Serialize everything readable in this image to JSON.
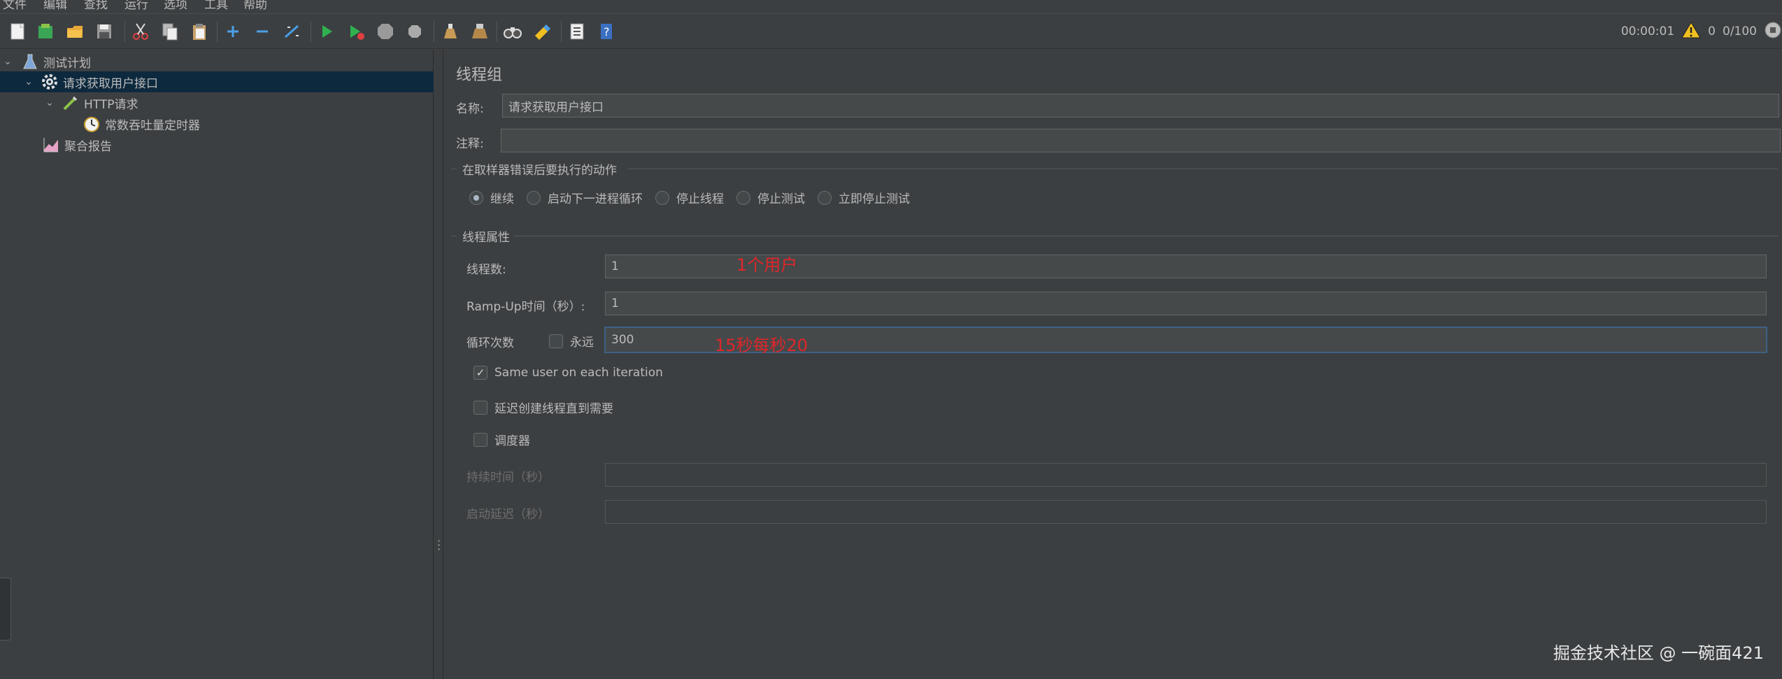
{
  "menu": [
    "文件",
    "编辑",
    "查找",
    "运行",
    "选项",
    "工具",
    "帮助"
  ],
  "toolbar": {
    "icons": [
      "new-icon",
      "templates-icon",
      "open-icon",
      "save-icon",
      "cut-icon",
      "copy-icon",
      "paste-icon",
      "add-icon",
      "remove-icon",
      "toggle-icon",
      "start-icon",
      "start-no-pause-icon",
      "stop-icon",
      "shutdown-icon",
      "clear-icon",
      "clear-all-icon",
      "search-icon",
      "reset-search-icon",
      "function-helper-icon",
      "help-icon"
    ]
  },
  "status": {
    "elapsed": "00:00:01",
    "warnings": "0",
    "threads": "0/100"
  },
  "tree": [
    {
      "label": "测试计划",
      "icon": "test-plan-icon"
    },
    {
      "label": "请求获取用户接口",
      "icon": "thread-group-icon"
    },
    {
      "label": "HTTP请求",
      "icon": "http-sampler-icon"
    },
    {
      "label": "常数吞吐量定时器",
      "icon": "timer-icon"
    },
    {
      "label": "聚合报告",
      "icon": "report-icon"
    }
  ],
  "panel": {
    "title": "线程组",
    "name_label": "名称:",
    "name_value": "请求获取用户接口",
    "comment_label": "注释:",
    "comment_value": "",
    "error_group_title": "在取样器错误后要执行的动作",
    "error_actions": [
      "继续",
      "启动下一进程循环",
      "停止线程",
      "停止测试",
      "立即停止测试"
    ],
    "error_selected": "继续",
    "thread_group_title": "线程属性",
    "threads_label": "线程数:",
    "threads_value": "1",
    "rampup_label": "Ramp-Up时间（秒）:",
    "rampup_value": "1",
    "loop_label": "循环次数",
    "forever_label": "永远",
    "forever_checked": false,
    "loop_value": "300",
    "same_user_label": "Same user on each iteration",
    "same_user_checked": true,
    "delay_label": "延迟创建线程直到需要",
    "delay_checked": false,
    "scheduler_label": "调度器",
    "scheduler_checked": false,
    "duration_label": "持续时间（秒）",
    "duration_value": "",
    "startup_delay_label": "启动延迟（秒）",
    "startup_delay_value": ""
  },
  "annotations": {
    "threads_note": "1个用户",
    "loop_note": "15秒每秒20"
  },
  "watermark": "掘金技术社区 @ 一碗面421",
  "colors": {
    "background": "#3c3f41",
    "selection": "#0d293e",
    "annotation": "#e0262a"
  }
}
